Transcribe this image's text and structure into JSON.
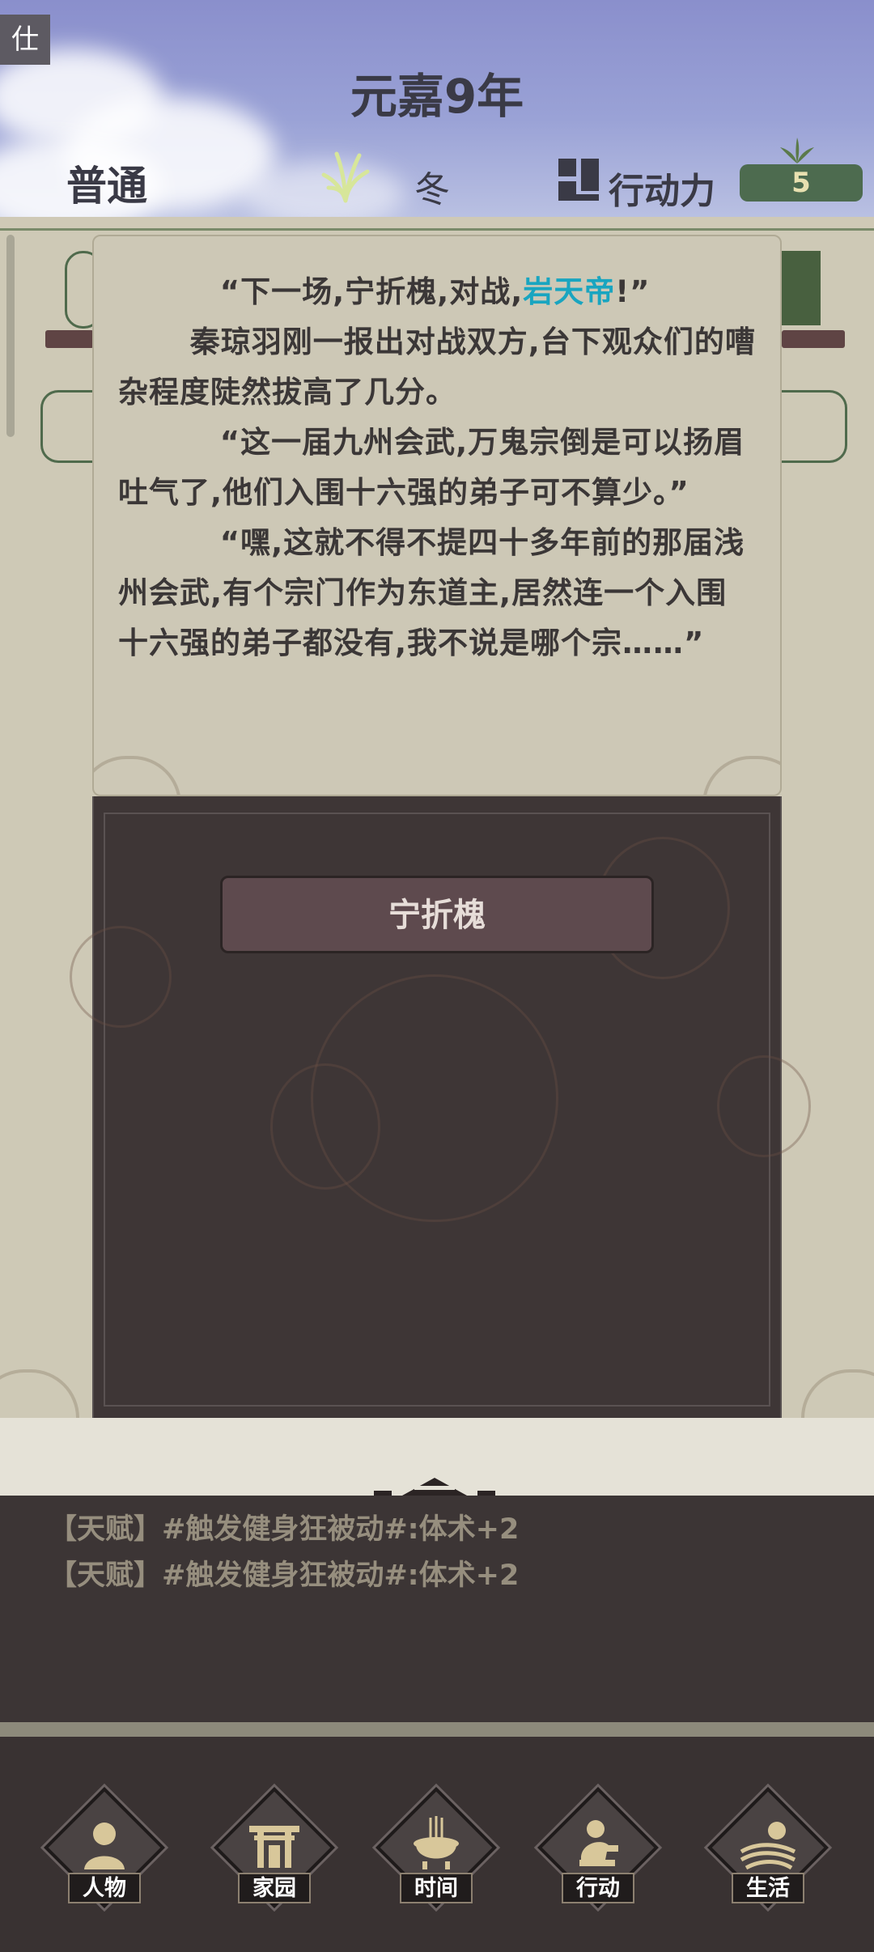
{
  "header": {
    "corner_tag": "仕",
    "year_title": "元嘉9年",
    "difficulty": "普通",
    "season": "冬",
    "action_points_label": "行动力",
    "action_points_value": "5"
  },
  "dialog": {
    "paragraphs": [
      {
        "before": "“下一场,宁折槐,对战,",
        "highlight": "岩天帝",
        "after": "!”"
      },
      {
        "before": "秦琼羽刚一报出对战双方,台下观众们的嘈杂程度陡然拔高了几分。",
        "highlight": "",
        "after": ""
      },
      {
        "before": "“这一届九州会武,万鬼宗倒是可以扬眉吐气了,他们入围十六强的弟子可不算少。”",
        "highlight": "",
        "after": ""
      },
      {
        "before": "“嘿,这就不得不提四十多年前的那届浅州会武,有个宗门作为东道主,居然连一个入围十六强的弟子都没有,我不说是哪个宗……”",
        "highlight": "",
        "after": ""
      }
    ],
    "highlight_color": "#19a5c0",
    "choice_label": "宁折槐"
  },
  "log": {
    "lines": [
      "【天赋】#触发健身狂被动#:体术+2",
      "【天赋】#触发健身狂被动#:体术+2"
    ]
  },
  "nav": {
    "items": [
      {
        "label": "人物",
        "icon": "person-icon"
      },
      {
        "label": "家园",
        "icon": "gate-icon"
      },
      {
        "label": "时间",
        "icon": "incense-burner-icon"
      },
      {
        "label": "行动",
        "icon": "action-figure-icon"
      },
      {
        "label": "生活",
        "icon": "farm-sun-icon"
      }
    ]
  },
  "colors": {
    "sky": "#8a8fcc",
    "parchment": "#cdc8b6",
    "dark_panel": "#3e3636",
    "ap_badge": "#4d6b4f",
    "log_text": "#968e7e"
  }
}
